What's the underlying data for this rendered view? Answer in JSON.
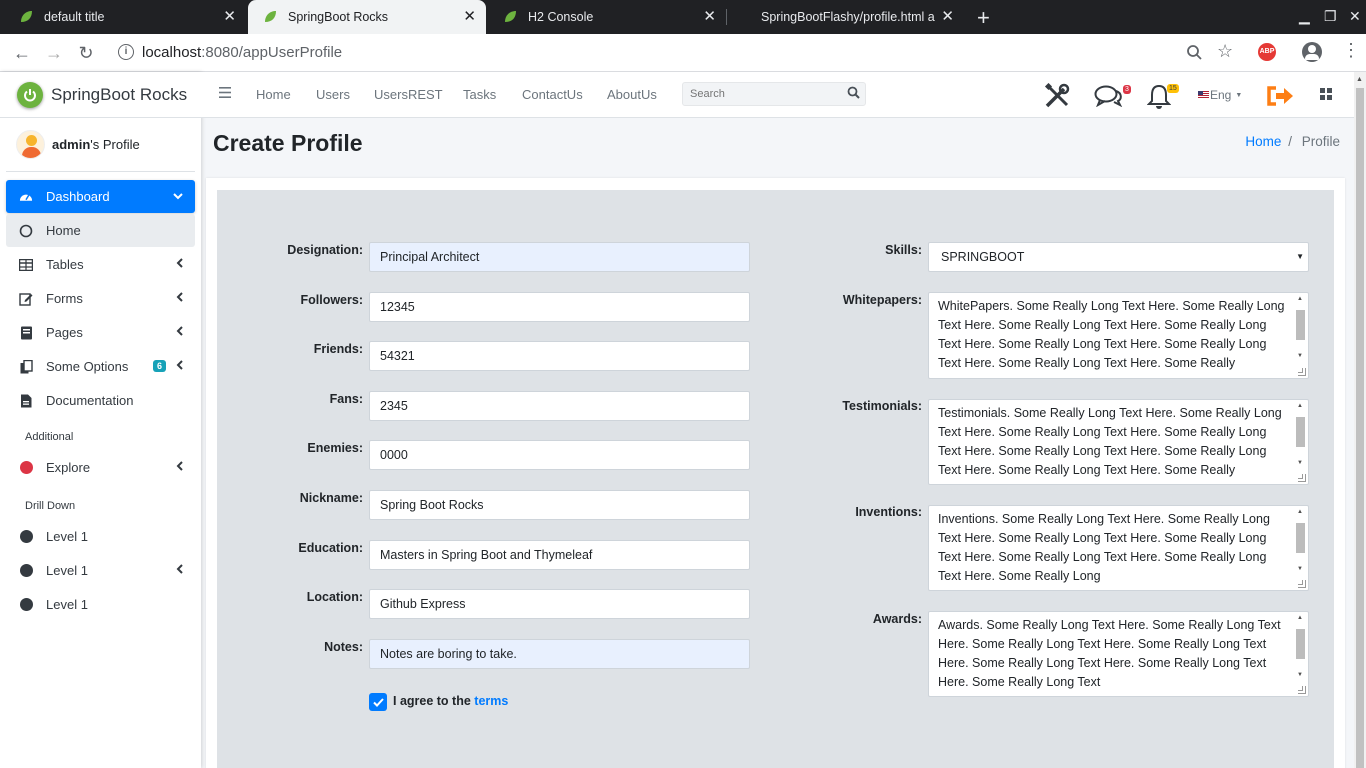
{
  "browser": {
    "tabs": [
      {
        "title": "default title"
      },
      {
        "title": "SpringBoot Rocks"
      },
      {
        "title": "H2 Console"
      },
      {
        "title": "SpringBootFlashy/profile.html a"
      }
    ],
    "url_host": "localhost",
    "url_path": ":8080/appUserProfile"
  },
  "sidebar": {
    "brand": "SpringBoot Rocks",
    "user_name": "admin",
    "user_suffix": "'s Profile",
    "menu": [
      {
        "label": "Dashboard"
      },
      {
        "label": "Home"
      },
      {
        "label": "Tables"
      },
      {
        "label": "Forms"
      },
      {
        "label": "Pages"
      },
      {
        "label": "Some Options",
        "badge": "6"
      },
      {
        "label": "Documentation"
      }
    ],
    "section_additional": "Additional",
    "explore": "Explore",
    "section_drill": "Drill Down",
    "levels": [
      "Level 1",
      "Level 1",
      "Level 1"
    ],
    "colors": {
      "active": "#007bff",
      "explore_dot": "#dc3545",
      "level_dot": "#343a40"
    }
  },
  "topnav": {
    "links": [
      "Home",
      "Users",
      "UsersREST",
      "Tasks",
      "ContactUs",
      "AboutUs"
    ],
    "search_placeholder": "Search",
    "messages_badge": "3",
    "notifications_badge": "15",
    "language": "Eng"
  },
  "page": {
    "title": "Create Profile",
    "breadcrumb_home": "Home",
    "breadcrumb_sep": "/",
    "breadcrumb_current": "Profile"
  },
  "form": {
    "designation": {
      "label": "Designation:",
      "value": "Principal Architect"
    },
    "followers": {
      "label": "Followers:",
      "value": "12345"
    },
    "friends": {
      "label": "Friends:",
      "value": "54321"
    },
    "fans": {
      "label": "Fans:",
      "value": "2345"
    },
    "enemies": {
      "label": "Enemies:",
      "value": "0000"
    },
    "nickname": {
      "label": "Nickname:",
      "value": "Spring Boot Rocks"
    },
    "education": {
      "label": "Education:",
      "value": "Masters in Spring Boot and Thymeleaf"
    },
    "location": {
      "label": "Location:",
      "value": "Github Express"
    },
    "notes": {
      "label": "Notes:",
      "value": "Notes are boring to take."
    },
    "skills": {
      "label": "Skills:",
      "value": "SPRINGBOOT"
    },
    "whitepapers": {
      "label": "Whitepapers:",
      "value": "WhitePapers. Some Really Long Text Here. Some Really Long Text Here. Some Really Long Text Here. Some Really Long Text Here. Some Really Long Text Here. Some Really Long Text Here. Some Really Long Text Here. Some Really"
    },
    "testimonials": {
      "label": "Testimonials:",
      "value": "Testimonials. Some Really Long Text Here. Some Really Long Text Here. Some Really Long Text Here. Some Really Long Text Here. Some Really Long Text Here. Some Really Long Text Here. Some Really Long Text Here. Some Really"
    },
    "inventions": {
      "label": "Inventions:",
      "value": "Inventions. Some Really Long Text Here. Some Really Long Text Here. Some Really Long Text Here. Some Really Long Text Here. Some Really Long Text Here. Some Really Long Text Here. Some Really Long"
    },
    "awards": {
      "label": "Awards:",
      "value": "Awards. Some Really Long Text Here. Some Really Long Text Here. Some Really Long Text Here. Some Really Long Text Here. Some Really Long Text Here. Some Really Long Text Here. Some Really Long Text"
    },
    "agree_text": "I agree to the",
    "terms_link": "terms"
  }
}
